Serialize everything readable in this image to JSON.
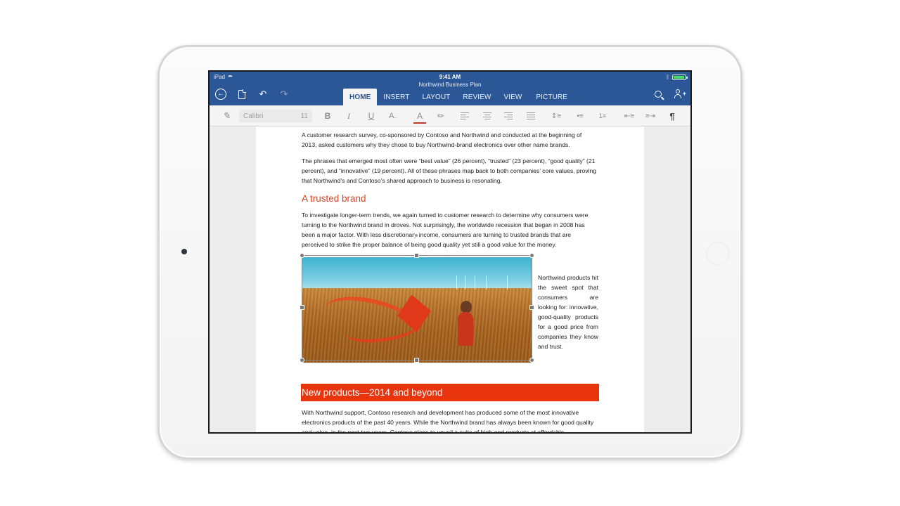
{
  "status": {
    "device": "iPad",
    "time": "9:41 AM",
    "battery_level": 0.95
  },
  "document": {
    "title": "Northwind Business Plan"
  },
  "tabs": [
    {
      "label": "HOME",
      "active": true
    },
    {
      "label": "INSERT",
      "active": false
    },
    {
      "label": "LAYOUT",
      "active": false
    },
    {
      "label": "REVIEW",
      "active": false
    },
    {
      "label": "VIEW",
      "active": false
    },
    {
      "label": "PICTURE",
      "active": false
    }
  ],
  "ribbon": {
    "font_name": "Calibri",
    "font_size": "11",
    "bold": "B",
    "italic": "I",
    "underline": "U",
    "font_effects": "A",
    "font_color": "A",
    "font_color_hex": "#c0392b",
    "pilcrow": "¶"
  },
  "icons": {
    "back": "back-arrow-icon",
    "file": "file-icon",
    "undo": "undo-icon",
    "redo": "redo-icon",
    "search": "search-icon",
    "share": "add-person-icon"
  },
  "colors": {
    "title_bar": "#2b5797",
    "heading_accent": "#d24726",
    "banner": "#e8350e"
  },
  "content": {
    "para1": "A customer research survey, co-sponsored by Contoso and Northwind and conducted at the beginning of 2013, asked customers why they chose to buy Northwind-brand electronics over other name brands.",
    "para2": "The phrases that emerged most often were “best value” (26 percent), “trusted” (23 percent), “good quality” (21 percent), and “innovative” (19 percent). All of these phrases map back to both companies’ core values, proving that Northwind’s and Contoso’s shared approach to business is resonating.",
    "heading1": "A trusted brand",
    "para3": "To investigate longer-term trends, we again turned to customer research to determine why consumers were turning to the Northwind brand in droves. Not surprisingly, the worldwide recession that began in 2008 has been a major factor. With less discretionary income, consumers are turning to trusted brands that are perceived to strike the proper balance of being good quality yet still a good value for the money.",
    "side_text": "Northwind products hit the sweet spot that consumers are looking for: innovative, good-quality products for a good price from companies they know and trust.",
    "heading2": "New products—2014 and beyond",
    "para4": "With Northwind support, Contoso research and development has produced some of the most innovative electronics products of the past 40 years. While the Northwind brand has always been known for good quality and value, in the next two years, Contoso plans to unveil a suite of high-end products at affordable"
  }
}
